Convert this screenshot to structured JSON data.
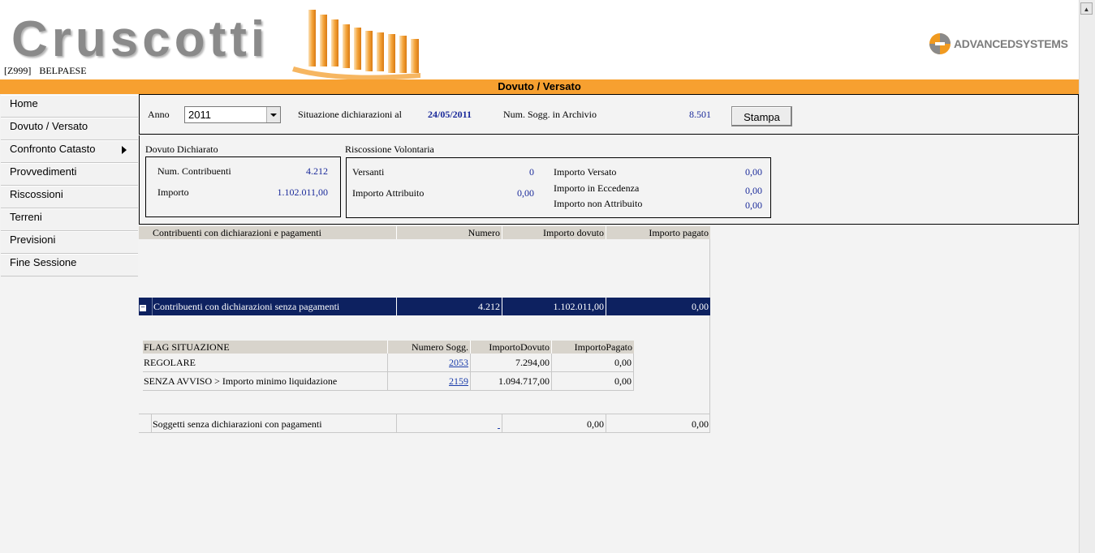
{
  "header": {
    "logo_text": "Cruscotti",
    "org_code": "[Z999]",
    "org_name": "BELPAESE",
    "vendor": "ADVANCEDSYSTEMS"
  },
  "page_title": "Dovuto / Versato",
  "sidebar": {
    "items": [
      {
        "label": "Home"
      },
      {
        "label": "Dovuto / Versato"
      },
      {
        "label": "Confronto Catasto"
      },
      {
        "label": "Provvedimenti"
      },
      {
        "label": "Riscossioni"
      },
      {
        "label": "Terreni"
      },
      {
        "label": "Previsioni"
      },
      {
        "label": "Fine Sessione"
      }
    ]
  },
  "filters": {
    "anno_label": "Anno",
    "anno_value": "2011",
    "situazione_label": "Situazione dichiarazioni al",
    "situazione_value": "24/05/2011",
    "num_sogg_label": "Num. Sogg. in Archivio",
    "num_sogg_value": "8.501",
    "print_button": "Stampa"
  },
  "dovuto_dichiarato": {
    "title": "Dovuto Dichiarato",
    "num_contribuenti_label": "Num. Contribuenti",
    "num_contribuenti_value": "4.212",
    "importo_label": "Importo",
    "importo_value": "1.102.011,00"
  },
  "riscossione_volontaria": {
    "title": "Riscossione Volontaria",
    "versanti_label": "Versanti",
    "versanti_value": "0",
    "importo_attribuito_label": "Importo Attribuito",
    "importo_attribuito_value": "0,00",
    "importo_versato_label": "Importo Versato",
    "importo_versato_value": "0,00",
    "importo_eccedenza_label": "Importo in Eccedenza",
    "importo_eccedenza_value": "0,00",
    "importo_non_attribuito_label": "Importo non Attribuito",
    "importo_non_attribuito_value": "0,00"
  },
  "main_table": {
    "headers": [
      "Contribuenti con dichiarazioni e pagamenti",
      "Numero",
      "Importo dovuto",
      "Importo pagato"
    ],
    "group_row": {
      "toggle": "−",
      "label": "Contribuenti con dichiarazioni senza pagamenti",
      "numero": "4.212",
      "importo_dovuto": "1.102.011,00",
      "importo_pagato": "0,00"
    },
    "footer_row": {
      "label": "Soggetti senza dichiarazioni con pagamenti",
      "numero": "",
      "importo_dovuto": "0,00",
      "importo_pagato": "0,00"
    }
  },
  "flag_table": {
    "headers": [
      "FLAG SITUAZIONE",
      "Numero Sogg.",
      "ImportoDovuto",
      "ImportoPagato"
    ],
    "rows": [
      {
        "flag": "REGOLARE",
        "numero": "2053",
        "dovuto": "7.294,00",
        "pagato": "0,00"
      },
      {
        "flag": "SENZA AVVISO > Importo minimo liquidazione",
        "numero": "2159",
        "dovuto": "1.094.717,00",
        "pagato": "0,00"
      }
    ]
  },
  "colors": {
    "orange": "#f7a030",
    "navy": "#0d2160",
    "value_blue": "#1a2a9a"
  }
}
